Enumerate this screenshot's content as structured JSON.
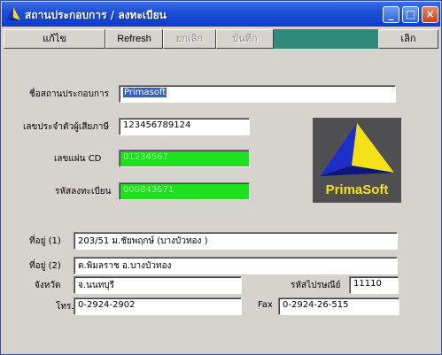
{
  "window": {
    "title": "สถานประกอบการ / ลงทะเบียน"
  },
  "toolbar": {
    "edit_label": "แก้ไข",
    "refresh_label": "Refresh",
    "cancel_label": "ยกเลิก",
    "save_label": "บันทึก",
    "exit_label": "เลิก"
  },
  "form": {
    "company_name": {
      "label": "ชื่อสถานประกอบการ",
      "value": "Primasoft"
    },
    "tax_id": {
      "label": "เลขประจำตัวผู้เสียภาษี",
      "value": "123456789124"
    },
    "cd_number": {
      "label": "เลขแผ่น CD",
      "value": "01234567"
    },
    "register_code": {
      "label": "รหัสลงทะเบียน",
      "value": "000843671"
    },
    "address1": {
      "label": "ที่อยู่ (1)",
      "value": "203/51 ม.ชัยพฤกษ์ (บางบัวทอง )"
    },
    "address2": {
      "label": "ที่อยู่ (2)",
      "value": "ต.พิมลราช  อ.บางบัวทอง"
    },
    "province": {
      "label": "จังหวัด",
      "value": "จ.นนทบุรี"
    },
    "postcode": {
      "label": "รหัสไปรษณีย์",
      "value": "11110"
    },
    "phone": {
      "label": "โทร.",
      "value": "0-2924-2902"
    },
    "fax": {
      "label": "Fax",
      "value": "0-2924-26-515"
    }
  },
  "logo": {
    "text": "PrimaSoft"
  },
  "colors": {
    "titlebar": "#0b3ccc",
    "window_bg": "#d6d3ce",
    "disabled_field": "#1fe01f",
    "logo_bg": "#4f4f52",
    "pyramid_yellow": "#f5e11a",
    "pyramid_blue": "#1e2fc8"
  }
}
